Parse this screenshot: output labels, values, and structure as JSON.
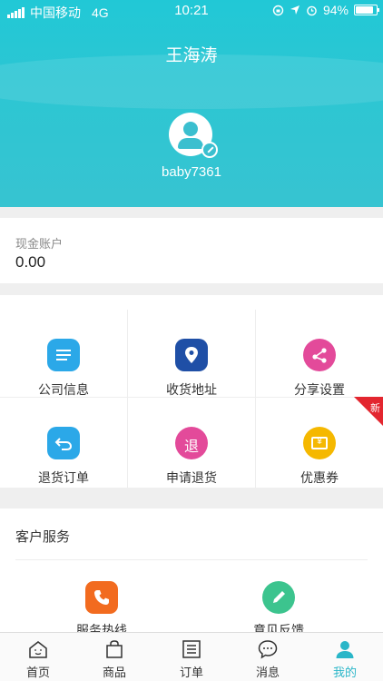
{
  "status_bar": {
    "carrier": "中国移动",
    "network": "4G",
    "time": "10:21",
    "battery": "94%"
  },
  "header": {
    "title": "王海涛",
    "username": "baby7361"
  },
  "account": {
    "label": "现金账户",
    "value": "0.00"
  },
  "grid": {
    "items": [
      {
        "label": "公司信息",
        "icon": "company-info-icon",
        "color": "#2ba8e8"
      },
      {
        "label": "收货地址",
        "icon": "location-pin-icon",
        "color": "#1f4fa6"
      },
      {
        "label": "分享设置",
        "icon": "share-icon",
        "color": "#e34a9a"
      },
      {
        "label": "退货订单",
        "icon": "return-arrow-icon",
        "color": "#2ba8e8"
      },
      {
        "label": "申请退货",
        "icon": "refund-icon",
        "icon_text": "退",
        "color": "#e34a9a"
      },
      {
        "label": "优惠券",
        "icon": "coupon-icon",
        "icon_text": "¥",
        "color": "#f5b800"
      }
    ],
    "new_badge": "新"
  },
  "service": {
    "title": "客户服务",
    "items": [
      {
        "label": "服务热线",
        "icon": "phone-icon",
        "color": "#f26b1f"
      },
      {
        "label": "意见反馈",
        "icon": "feedback-pencil-icon",
        "color": "#3cc48e"
      }
    ]
  },
  "tabbar": {
    "items": [
      {
        "label": "首页",
        "icon": "home-icon"
      },
      {
        "label": "商品",
        "icon": "bag-icon"
      },
      {
        "label": "订单",
        "icon": "order-list-icon"
      },
      {
        "label": "消息",
        "icon": "message-icon"
      },
      {
        "label": "我的",
        "icon": "user-icon"
      }
    ],
    "active": "我的",
    "active_color": "#2ab6c8"
  }
}
